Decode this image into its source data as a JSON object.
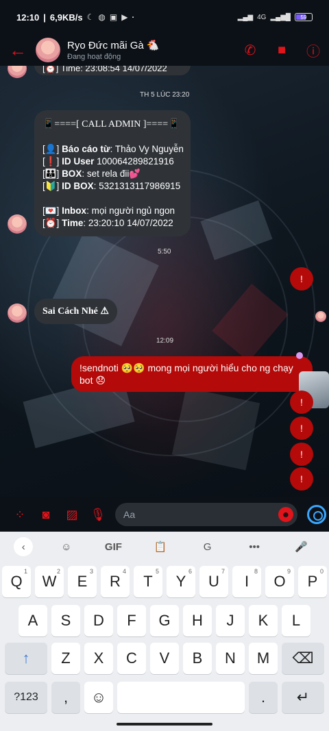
{
  "status_bar": {
    "time": "12:10",
    "speed": "6,9KB/s",
    "icons": [
      "moon-icon",
      "messenger-icon",
      "bag-icon",
      "youtube-icon",
      "dot"
    ],
    "network": "4G",
    "battery": "59",
    "battery_level": 0.59
  },
  "header": {
    "name": "Ryo Đức mãi Gà 🐔",
    "status": "Đang hoạt động",
    "colors": {
      "accent": "#e0141b"
    }
  },
  "chat": {
    "partial_top": "[⏰] Time: 23:08:54 14/07/2022",
    "timestamps": [
      "TH 5 LÚC 23:20",
      "5:50",
      "12:09"
    ],
    "admin_message": {
      "title": "📱====[ CALL ADMIN ]====📱",
      "reported_by_label": "Báo cáo từ",
      "reported_by": "Thảo Vy Nguyễn",
      "id_user_label": "ID User",
      "id_user": "100064289821916",
      "box_label": "BOX",
      "box": "set rela đii💕",
      "id_box_label": "ID BOX",
      "id_box": "5321313117986915",
      "inbox_label": "Inbox",
      "inbox": "mọi người ngủ ngon",
      "time_label": "Time",
      "time": "23:20:10 14/07/2022"
    },
    "reply_message": "Sai Cách Nhé ⚠",
    "outgoing_message": "!sendnoti 🥺🥺 mong mọi người hiểu cho ng chạy bot 😞",
    "exclaims": [
      "!",
      "!",
      "!",
      "!",
      "!",
      "!"
    ]
  },
  "composer": {
    "placeholder": "Aa"
  },
  "keyboard": {
    "toolbar": [
      "‹",
      "☺",
      "GIF",
      "📋",
      "G",
      "•••",
      "🎤"
    ],
    "row1": [
      {
        "k": "Q",
        "n": "1"
      },
      {
        "k": "W",
        "n": "2"
      },
      {
        "k": "E",
        "n": "3"
      },
      {
        "k": "R",
        "n": "4"
      },
      {
        "k": "T",
        "n": "5"
      },
      {
        "k": "Y",
        "n": "6"
      },
      {
        "k": "U",
        "n": "7"
      },
      {
        "k": "I",
        "n": "8"
      },
      {
        "k": "O",
        "n": "9"
      },
      {
        "k": "P",
        "n": "0"
      }
    ],
    "row2": [
      "A",
      "S",
      "D",
      "F",
      "G",
      "H",
      "J",
      "K",
      "L"
    ],
    "row3": [
      "Z",
      "X",
      "C",
      "V",
      "B",
      "N",
      "M"
    ],
    "shift": "↑",
    "backspace": "⌫",
    "symbols": "?123",
    "comma": ",",
    "emoji": "☺",
    "period": ".",
    "enter": "↵"
  }
}
